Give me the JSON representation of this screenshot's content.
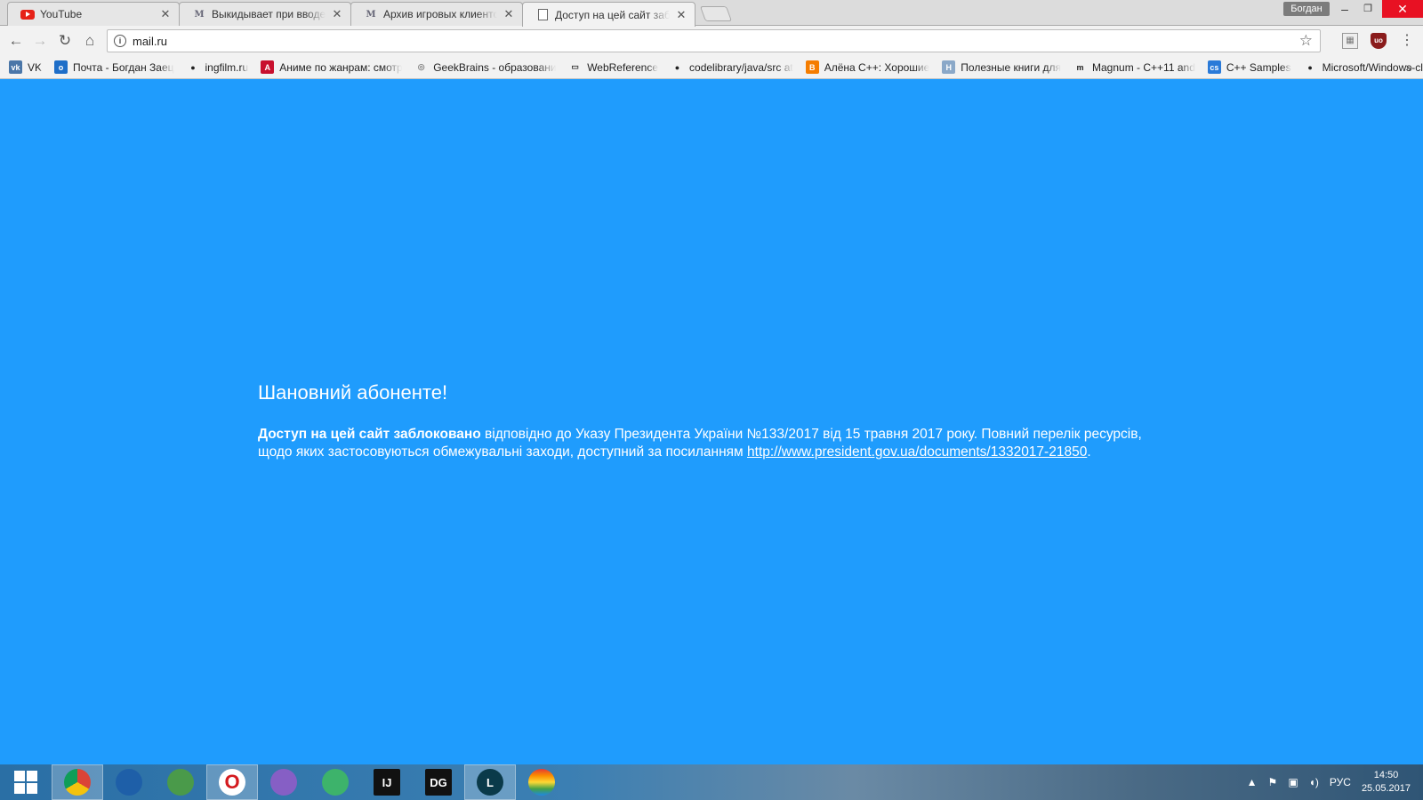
{
  "browser": {
    "tabs": [
      {
        "title": "YouTube",
        "icon": "youtube-icon",
        "active": false
      },
      {
        "title": "Выкидывает при вводе",
        "icon": "m-site-icon",
        "active": false
      },
      {
        "title": "Архив игровых клиентов",
        "icon": "m-site-icon",
        "active": false
      },
      {
        "title": "Доступ на цей сайт заблоковано",
        "icon": "document-icon",
        "active": true
      }
    ],
    "profile_name": "Богдан",
    "url": "mail.ru"
  },
  "bookmarks": [
    {
      "label": "VK",
      "icon": "vk-icon",
      "color": "#4a76a8"
    },
    {
      "label": "Почта - Богдан Заец",
      "icon": "mail-icon",
      "color": "#1e6ec8"
    },
    {
      "label": "ingfilm.ru",
      "icon": "film-icon",
      "color": "#222222"
    },
    {
      "label": "Аниме по жанрам: смотреть",
      "icon": "anime-icon",
      "color": "#c8102e"
    },
    {
      "label": "GeekBrains - образование",
      "icon": "geekbrains-icon",
      "color": "#888888"
    },
    {
      "label": "WebReference",
      "icon": "chat-icon",
      "color": "#333333"
    },
    {
      "label": "codelibrary/java/src at",
      "icon": "github-icon",
      "color": "#222222"
    },
    {
      "label": "Алёна С++: Хорошие",
      "icon": "blogger-icon",
      "color": "#f57d00"
    },
    {
      "label": "Полезные книги для",
      "icon": "h-site-icon",
      "color": "#8aa8c8"
    },
    {
      "label": "Magnum - C++11 and",
      "icon": "magnum-icon",
      "color": "#222222"
    },
    {
      "label": "C++ Samples",
      "icon": "cs-icon",
      "color": "#2a7ad8"
    },
    {
      "label": "Microsoft/Windows-classic",
      "icon": "github-icon",
      "color": "#222222"
    }
  ],
  "page": {
    "heading": "Шановний абоненте!",
    "message_bold": "Доступ на цей сайт заблоковано",
    "message_text": " відповідно до Указу Президента України №133/2017 від 15 травня 2017 року. Повний перелік ресурсів, щодо яких застосовуються обмежувальні заходи, доступний за посиланням ",
    "link_text": "http://www.president.gov.ua/documents/1332017-21850",
    "message_end": ".",
    "background_color": "#1f9cfd"
  },
  "taskbar": {
    "apps": [
      {
        "name": "chrome",
        "icon": "chrome-icon",
        "color": "#db4437",
        "glyph": "",
        "active": true
      },
      {
        "name": "firefox",
        "icon": "firefox-icon",
        "color": "#1e5fa8",
        "glyph": "",
        "active": false
      },
      {
        "name": "globe",
        "icon": "globe-icon",
        "color": "#4a9a4a",
        "glyph": "",
        "active": false
      },
      {
        "name": "opera",
        "icon": "opera-icon",
        "color": "#d41a1f",
        "glyph": "O",
        "active": true
      },
      {
        "name": "visual-studio",
        "icon": "visual-studio-icon",
        "color": "#865fc5",
        "glyph": "",
        "active": false
      },
      {
        "name": "atom",
        "icon": "atom-icon",
        "color": "#3db36b",
        "glyph": "",
        "active": false
      },
      {
        "name": "intellij",
        "icon": "intellij-icon",
        "color": "#111111",
        "glyph": "IJ",
        "active": false
      },
      {
        "name": "datagrip",
        "icon": "datagrip-icon",
        "color": "#111111",
        "glyph": "DG",
        "active": false
      },
      {
        "name": "league-of-legends",
        "icon": "league-icon",
        "color": "#0a3a4a",
        "glyph": "L",
        "active": true
      },
      {
        "name": "game",
        "icon": "rainbow-icon",
        "color": "#e8a020",
        "glyph": "",
        "active": false
      }
    ],
    "language": "РУС",
    "time": "14:50",
    "date": "25.05.2017"
  }
}
